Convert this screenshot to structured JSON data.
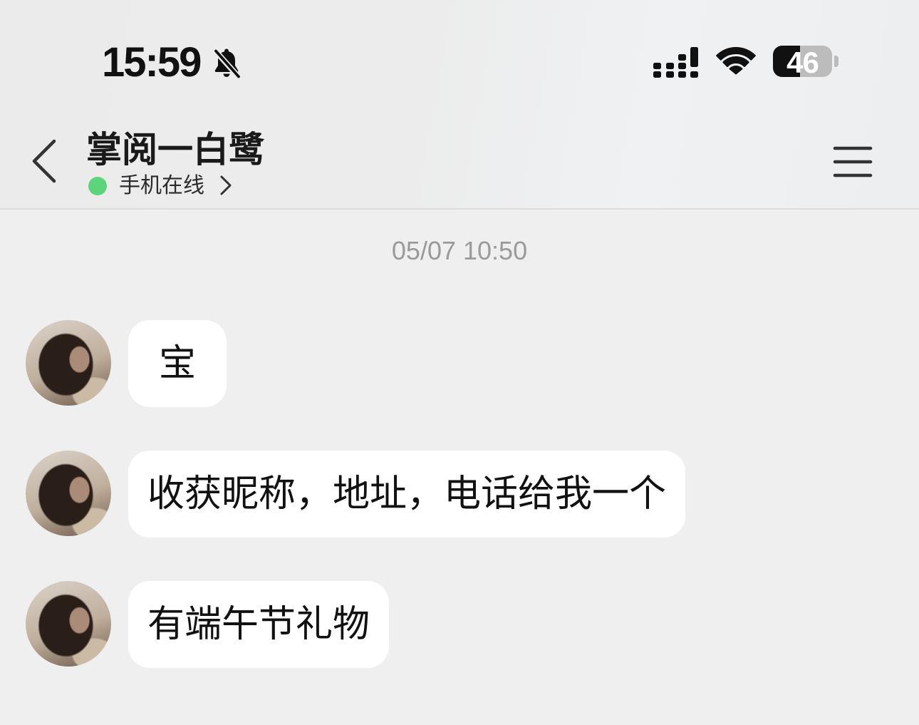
{
  "status_bar": {
    "time": "15:59",
    "mute_icon": "bell-slash-icon",
    "signal_icon": "cellular-signal-icon",
    "wifi_icon": "wifi-icon",
    "battery": {
      "label": "46",
      "level_percent": 46,
      "icon": "battery-icon"
    }
  },
  "header": {
    "back_icon": "chevron-left-icon",
    "title": "掌阅一白鹭",
    "online_status": "手机在线",
    "online_indicator_color": "#5cd47c",
    "status_chevron_icon": "chevron-right-icon",
    "menu_icon": "menu-icon"
  },
  "chat": {
    "timestamp": "05/07 10:50",
    "messages": [
      {
        "text": "宝"
      },
      {
        "text": "收获昵称，地址，电话给我一个"
      },
      {
        "text": "有端午节礼物"
      }
    ]
  },
  "colors": {
    "background": "#efefef",
    "bubble": "#ffffff",
    "message_text": "#111111",
    "timestamp_text": "#9a9a9a",
    "divider": "#dcdcdc"
  }
}
